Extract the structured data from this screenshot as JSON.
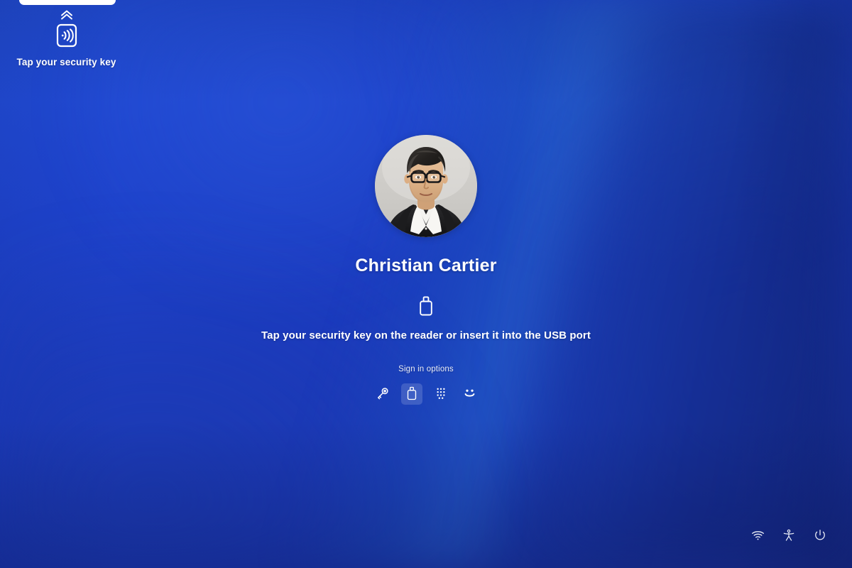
{
  "security_key_prompt": {
    "icon": "nfc-contactless-icon",
    "expand_icon": "double-chevron-up-icon",
    "text": "Tap your security key"
  },
  "login": {
    "avatar": "user-avatar-photo",
    "user_name": "Christian Cartier",
    "method_icon": "usb-security-key-icon",
    "hint": "Tap your security key on the reader or insert it into the USB port",
    "sign_in_options_label": "Sign in options",
    "sign_in_options": [
      {
        "name": "password-option",
        "icon": "key-icon",
        "label": "Password",
        "selected": false
      },
      {
        "name": "security-key-option",
        "icon": "usb-security-key-icon",
        "label": "Security key",
        "selected": true
      },
      {
        "name": "pin-option",
        "icon": "pin-keypad-icon",
        "label": "PIN",
        "selected": false
      },
      {
        "name": "face-option",
        "icon": "face-smiley-icon",
        "label": "Face recognition",
        "selected": false
      }
    ]
  },
  "tray": {
    "items": [
      {
        "name": "network-button",
        "icon": "wifi-icon",
        "label": "Network"
      },
      {
        "name": "accessibility-button",
        "icon": "accessibility-person-icon",
        "label": "Accessibility"
      },
      {
        "name": "power-button",
        "icon": "power-icon",
        "label": "Power"
      }
    ]
  },
  "colors": {
    "background_primary": "#1f41c8",
    "background_deep": "#1c3096",
    "background_light_band": "#2c6ad0",
    "text_primary": "#ffffff",
    "text_secondary": "#e9ecf6",
    "selected_overlay": "rgba(255,255,255,0.16)"
  }
}
